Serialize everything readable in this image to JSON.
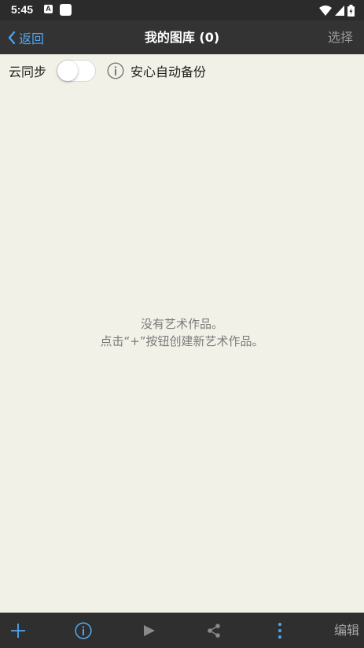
{
  "status_bar": {
    "time": "5:45",
    "notification_letter": "A"
  },
  "nav": {
    "back_label": "返回",
    "title": "我的图库 (0)",
    "select_label": "选择"
  },
  "sync": {
    "label": "云同步",
    "toggle_on": false,
    "backup_label": "安心自动备份"
  },
  "empty": {
    "line1": "没有艺术作品。",
    "line2": "点击“+”按钮创建新艺术作品。"
  },
  "toolbar": {
    "icons": [
      "plus-icon",
      "info-icon",
      "play-icon",
      "share-icon",
      "more-vertical-icon"
    ],
    "edit_label": "编辑"
  },
  "colors": {
    "accent": "#4ea6f0",
    "background": "#f2f1e7",
    "bar": "#333333"
  }
}
